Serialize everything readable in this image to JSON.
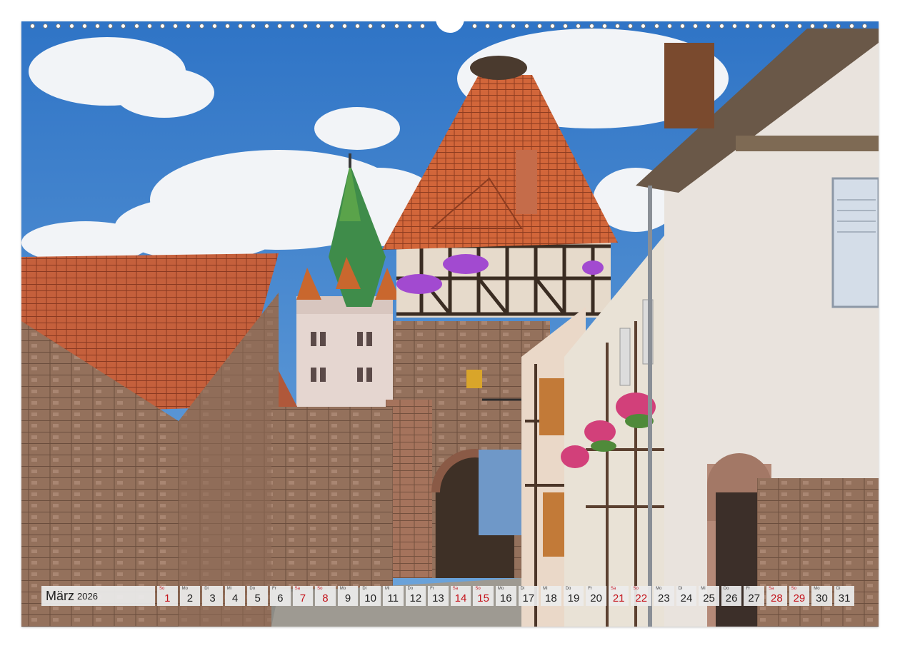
{
  "calendar": {
    "month": "März",
    "year": "2026",
    "days": [
      {
        "wd": "So",
        "num": "1",
        "red": true
      },
      {
        "wd": "Mo",
        "num": "2",
        "red": false
      },
      {
        "wd": "Di",
        "num": "3",
        "red": false
      },
      {
        "wd": "Mi",
        "num": "4",
        "red": false
      },
      {
        "wd": "Do",
        "num": "5",
        "red": false
      },
      {
        "wd": "Fr",
        "num": "6",
        "red": false
      },
      {
        "wd": "Sa",
        "num": "7",
        "red": true
      },
      {
        "wd": "So",
        "num": "8",
        "red": true
      },
      {
        "wd": "Mo",
        "num": "9",
        "red": false
      },
      {
        "wd": "Di",
        "num": "10",
        "red": false
      },
      {
        "wd": "Mi",
        "num": "11",
        "red": false
      },
      {
        "wd": "Do",
        "num": "12",
        "red": false
      },
      {
        "wd": "Fr",
        "num": "13",
        "red": false
      },
      {
        "wd": "Sa",
        "num": "14",
        "red": true
      },
      {
        "wd": "So",
        "num": "15",
        "red": true
      },
      {
        "wd": "Mo",
        "num": "16",
        "red": false
      },
      {
        "wd": "Di",
        "num": "17",
        "red": false
      },
      {
        "wd": "Mi",
        "num": "18",
        "red": false
      },
      {
        "wd": "Do",
        "num": "19",
        "red": false
      },
      {
        "wd": "Fr",
        "num": "20",
        "red": false
      },
      {
        "wd": "Sa",
        "num": "21",
        "red": true
      },
      {
        "wd": "So",
        "num": "22",
        "red": true
      },
      {
        "wd": "Mo",
        "num": "23",
        "red": false
      },
      {
        "wd": "Di",
        "num": "24",
        "red": false
      },
      {
        "wd": "Mi",
        "num": "25",
        "red": false
      },
      {
        "wd": "Do",
        "num": "26",
        "red": false
      },
      {
        "wd": "Fr",
        "num": "27",
        "red": false
      },
      {
        "wd": "Sa",
        "num": "28",
        "red": true
      },
      {
        "wd": "So",
        "num": "29",
        "red": true
      },
      {
        "wd": "Mo",
        "num": "30",
        "red": false
      },
      {
        "wd": "Di",
        "num": "31",
        "red": false
      }
    ]
  },
  "colors": {
    "sky": "#3a80cc",
    "roof_tiles": "#c8572e",
    "stone_wall": "#9a7460",
    "half_timber": "#e8dccb",
    "weekend_red": "#c4141c"
  }
}
